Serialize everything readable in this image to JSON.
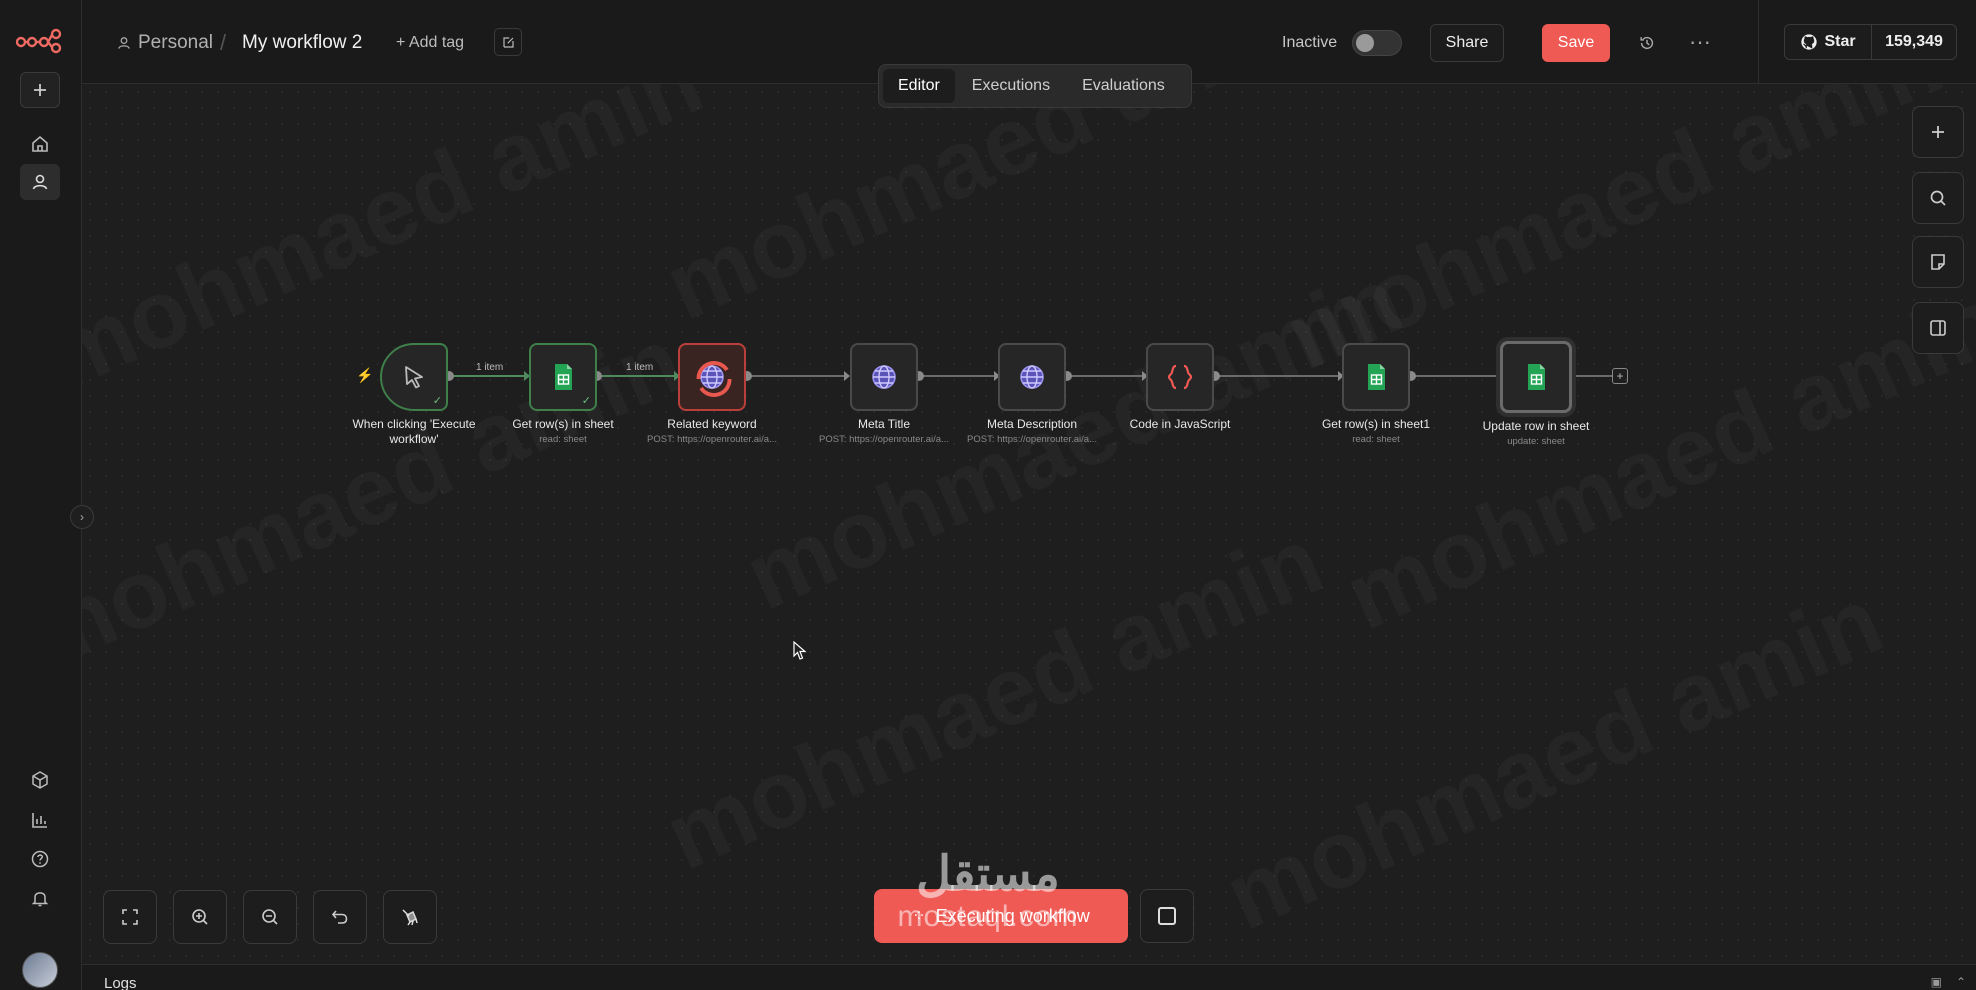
{
  "header": {
    "project": "Personal",
    "separator": "/",
    "workflow_name": "My workflow 2",
    "add_tag": "+ Add tag",
    "status_label": "Inactive",
    "share_label": "Share",
    "save_label": "Save",
    "more_label": "···",
    "github_star": "Star",
    "github_count": "159,349"
  },
  "tabs": [
    {
      "label": "Editor",
      "active": true
    },
    {
      "label": "Executions",
      "active": false
    },
    {
      "label": "Evaluations",
      "active": false
    }
  ],
  "nodes": [
    {
      "label": "When clicking 'Execute workflow'",
      "sub": "",
      "icon": "cursor-icon",
      "state": "success"
    },
    {
      "label": "Get row(s) in sheet",
      "sub": "read: sheet",
      "icon": "google-sheets-icon",
      "state": "success"
    },
    {
      "label": "Related keyword",
      "sub": "POST: https://openrouter.ai/a...",
      "icon": "globe-icon",
      "state": "running"
    },
    {
      "label": "Meta Title",
      "sub": "POST: https://openrouter.ai/a...",
      "icon": "globe-icon",
      "state": "idle"
    },
    {
      "label": "Meta Description",
      "sub": "POST: https://openrouter.ai/a...",
      "icon": "globe-icon",
      "state": "idle"
    },
    {
      "label": "Code in JavaScript",
      "sub": "",
      "icon": "code-braces-icon",
      "state": "idle"
    },
    {
      "label": "Get row(s) in sheet1",
      "sub": "read: sheet",
      "icon": "google-sheets-icon",
      "state": "idle"
    },
    {
      "label": "Update row in sheet",
      "sub": "update: sheet",
      "icon": "google-sheets-icon",
      "state": "selected"
    }
  ],
  "connections": {
    "item_label_1": "1 item",
    "item_label_2": "1 item"
  },
  "canvas": {
    "watermark_text": "mohmaed amin",
    "execute_label": "Executing workflow",
    "overlay_logo_ar": "مستقل",
    "overlay_logo_en": "mostaql.com"
  },
  "logs": {
    "label": "Logs"
  },
  "colors": {
    "accent": "#ef5a54",
    "success": "#4f8a5c",
    "sheets_green": "#23a455",
    "globe_purple": "#8f86e8"
  }
}
